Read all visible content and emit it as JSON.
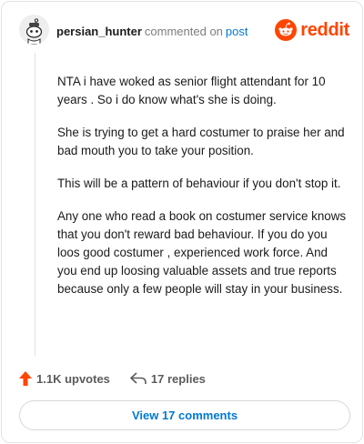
{
  "header": {
    "username": "persian_hunter",
    "action_text": "commented on",
    "post_link": "post",
    "brand": "reddit"
  },
  "comment": {
    "paragraphs": [
      "NTA i have woked as senior flight attendant for 10 years . So i do know what's she is doing.",
      "She is trying to get a hard costumer to praise her and bad mouth you to take your position.",
      "This will be a pattern of behaviour if you don't stop it.",
      "Any one who read a book on costumer service knows that you don't reward bad behaviour. If you do you loos good costumer , experienced work force. And you end up loosing valuable assets and true reports because only a few people will stay in your business."
    ]
  },
  "actions": {
    "upvotes": "1.1K upvotes",
    "replies": "17 replies",
    "view_comments": "View 17 comments"
  },
  "colors": {
    "brand": "#ff4500",
    "link": "#0079d3"
  }
}
